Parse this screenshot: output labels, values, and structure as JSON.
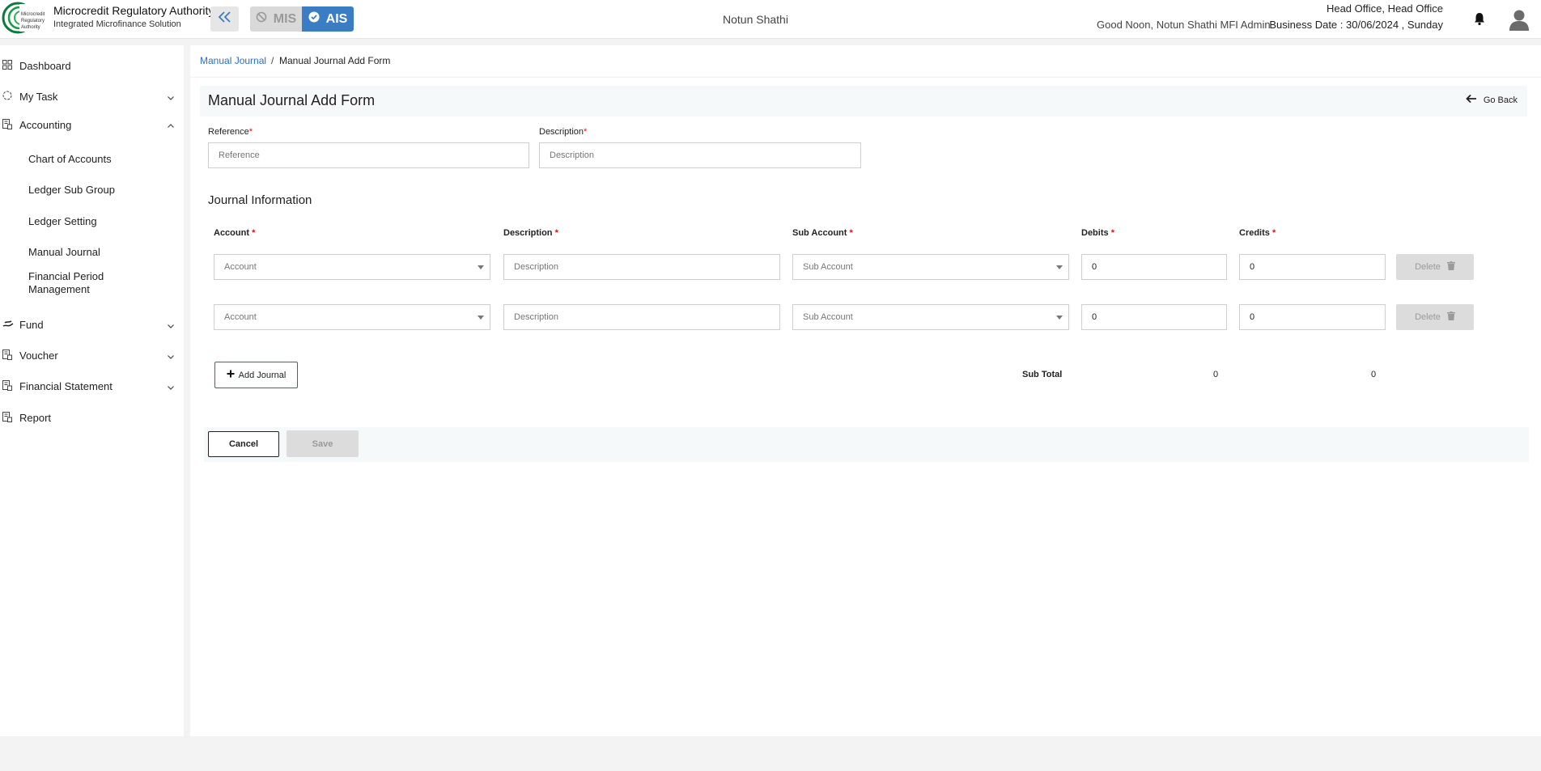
{
  "header": {
    "org_title": "Microcredit Regulatory Authority",
    "org_subtitle": "Integrated Microfinance Solution",
    "logo_text": "Microcredit Regulatory Authority",
    "mis_label": "MIS",
    "ais_label": "AIS",
    "center_title": "Notun Shathi",
    "greeting": "Good Noon, Notun Shathi MFI Admin",
    "office": "Head Office, Head Office",
    "business_date": "Business Date : 30/06/2024 , Sunday",
    "accent_color": "#3a7dc4"
  },
  "sidebar": {
    "items": [
      {
        "label": "Dashboard",
        "icon": "grid-icon"
      },
      {
        "label": "My Task",
        "icon": "circle-dashed-icon",
        "expanded": false
      },
      {
        "label": "Accounting",
        "icon": "ledger-icon",
        "expanded": true
      },
      {
        "label": "Fund",
        "icon": "hand-money-icon",
        "expanded": false
      },
      {
        "label": "Voucher",
        "icon": "ledger-icon",
        "expanded": false
      },
      {
        "label": "Financial Statement",
        "icon": "ledger-icon",
        "expanded": false
      },
      {
        "label": "Report",
        "icon": "ledger-icon"
      }
    ],
    "accounting_sub": [
      "Chart of Accounts",
      "Ledger Sub Group",
      "Ledger Setting",
      "Manual Journal",
      "Financial Period Management"
    ]
  },
  "breadcrumb": {
    "link": "Manual Journal",
    "separator": "/",
    "current": "Manual Journal Add Form"
  },
  "form": {
    "title": "Manual Journal Add Form",
    "go_back": "Go Back",
    "reference": {
      "label": "Reference",
      "placeholder": "Reference",
      "value": ""
    },
    "description": {
      "label": "Description",
      "placeholder": "Description",
      "value": ""
    },
    "required_mark": "*"
  },
  "journal": {
    "section_title": "Journal Information",
    "columns": [
      "Account",
      "Description",
      "Sub Account",
      "Debits",
      "Credits"
    ],
    "rows": [
      {
        "account_placeholder": "Account",
        "description_placeholder": "Description",
        "sub_account_placeholder": "Sub Account",
        "debits": "0",
        "credits": "0",
        "delete_label": "Delete"
      },
      {
        "account_placeholder": "Account",
        "description_placeholder": "Description",
        "sub_account_placeholder": "Sub Account",
        "debits": "0",
        "credits": "0",
        "delete_label": "Delete"
      }
    ],
    "add_label": "Add Journal",
    "subtotal_label": "Sub Total",
    "subtotal_debits": "0",
    "subtotal_credits": "0"
  },
  "actions": {
    "cancel": "Cancel",
    "save": "Save"
  }
}
